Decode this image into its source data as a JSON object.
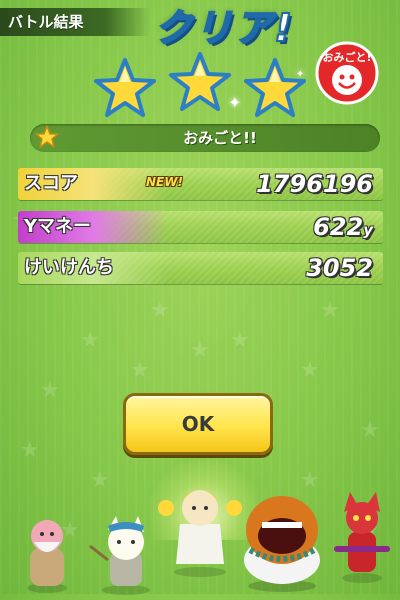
{
  "header": {
    "result_label": "バトル結果",
    "title": "クリア!",
    "rank_stars": 3,
    "rank_stars_max": 3
  },
  "badge": {
    "text": "おみごと!"
  },
  "comment": {
    "text": "おみごと!!"
  },
  "stats": [
    {
      "label": "スコア",
      "value": "1796196",
      "unit": "",
      "tag": "NEW!",
      "label_color": "#f0d23a"
    },
    {
      "label": "Yマネー",
      "value": "622",
      "unit": "y",
      "tag": "",
      "label_color": "#d04ad8"
    },
    {
      "label": "けいけんち",
      "value": "3052",
      "unit": "",
      "tag": "",
      "label_color": "#b7e06e"
    }
  ],
  "ok_button": {
    "label": "OK"
  },
  "colors": {
    "background": "#86c84a",
    "title_outline": "#1f6aa8",
    "star_fill": "#ffd83a",
    "star_outline": "#2c7fc4",
    "button_fill": "#ffe44a"
  }
}
